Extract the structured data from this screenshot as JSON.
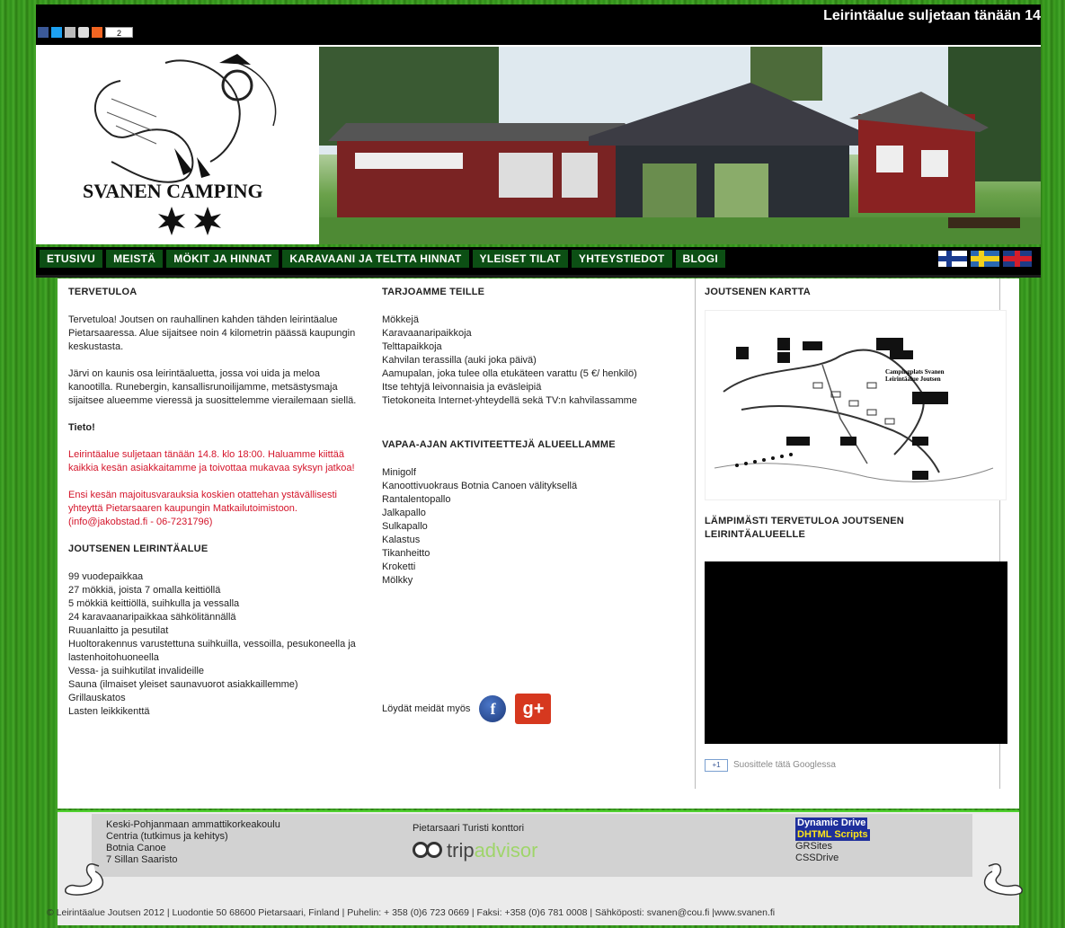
{
  "ticker": "Leirintäalue suljetaan tänään 14",
  "share": {
    "count": "2"
  },
  "logo": {
    "title": "SVANEN CAMPING"
  },
  "nav": {
    "items": [
      "ETUSIVU",
      "MEISTÄ",
      "MÖKIT JA HINNAT",
      "KARAVAANI JA TELTTA HINNAT",
      "YLEISET TILAT",
      "YHTEYSTIEDOT",
      "BLOGI"
    ]
  },
  "col1": {
    "heading": "TERVETULOA",
    "p1": "Tervetuloa! Joutsen on rauhallinen kahden tähden leirintäalue Pietarsaaressa. Alue sijaitsee noin 4 kilometrin päässä kaupungin keskustasta.",
    "p2": "Järvi on kaunis osa leirintäaluetta, jossa voi uida ja meloa kanootilla. Runebergin, kansallisrunoilijamme, metsästysmaja sijaitsee alueemme vieressä ja suosittelemme vierailemaan siellä.",
    "tieto": "Tieto!",
    "red1": "Leirintäalue suljetaan tänään 14.8. klo 18:00. Haluamme kiittää kaikkia kesän asiakkaitamme ja toivottaa mukavaa syksyn jatkoa!",
    "red2": "Ensi kesän majoitusvarauksia koskien otattehan ystävällisesti yhteyttä Pietarsaaren kaupungin Matkailutoimistoon. (info@jakobstad.fi - 06-7231796)",
    "heading2": "JOUTSENEN LEIRINTÄALUE",
    "list": [
      "99 vuodepaikkaa",
      "27 mökkiä, joista 7 omalla keittiöllä",
      "5 mökkiä keittiöllä, suihkulla ja vessalla",
      "24 karavaanaripaikkaa sähkölitännällä",
      "Ruuanlaitto ja pesutilat",
      "Huoltorakennus varustettuna suihkuilla, vessoilla, pesukoneella ja lastenhoitohuoneella",
      "Vessa- ja suihkutilat invalideille",
      "Sauna (ilmaiset yleiset saunavuorot asiakkaillemme)",
      "Grillauskatos",
      "Lasten leikkikenttä"
    ]
  },
  "col2": {
    "heading": "TARJOAMME TEILLE",
    "offers": [
      "Mökkejä",
      "Karavaanaripaikkoja",
      "Telttapaikkoja",
      "Kahvilan terassilla (auki joka päivä)",
      "Aamupalan, joka tulee olla etukäteen varattu (5 €/ henkilö)",
      "Itse tehtyjä leivonnaisia ja eväsleipiä",
      "Tietokoneita Internet-yhteydellä sekä TV:n kahvilassamme"
    ],
    "heading2": "VAPAA-AJAN AKTIVITEETTEJÄ ALUEELLAMME",
    "activities": [
      "Minigolf",
      "Kanoottivuokraus Botnia Canoen välityksellä",
      "Rantalentopallo",
      "Jalkapallo",
      "Sulkapallo",
      "Kalastus",
      "Tikanheitto",
      "Kroketti",
      "Mölkky"
    ],
    "find_us": "Löydät meidät myös",
    "fb_glyph": "f",
    "gplus_glyph": "g+"
  },
  "col3": {
    "map_heading": "JOUTSENEN KARTTA",
    "map_title": "Campingplats Svanen",
    "map_subtitle": "Leirintäalue Joutsen",
    "welcome_heading": "LÄMPIMÄSTI TERVETULOA JOUTSENEN LEIRINTÄALUEELLE",
    "gplus_badge": "+1",
    "gplus_rec": "Suosittele tätä Googlessa"
  },
  "footer": {
    "partners_left": [
      "Keski-Pohjanmaan ammattikorkeakoulu",
      "Centria (tutkimus ja kehitys)",
      "Botnia Canoe",
      "7 Sillan Saaristo"
    ],
    "partners_mid": "Pietarsaari Turisti konttori",
    "trip_a": "trip",
    "trip_b": "advisor",
    "dynamic_drive": "Dynamic Drive",
    "dhtml": "DHTML Scripts",
    "grsites": "GRSites",
    "cssdrive": "CSSDrive",
    "copyright": "© Leirintäalue Joutsen 2012 | Luodontie 50 68600 Pietarsaari, Finland | Puhelin: + 358 (0)6 723 0669 | Faksi: +358 (0)6 781 0008 | Sähköposti: svanen@cou.fi |www.svanen.fi"
  }
}
